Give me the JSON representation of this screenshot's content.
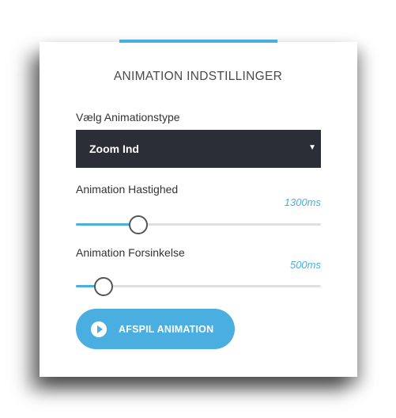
{
  "panel": {
    "title": "ANIMATION INDSTILLINGER"
  },
  "animation_type": {
    "label": "Vælg Animationstype",
    "selected": "Zoom Ind",
    "caret_icon": "triangle-down-icon"
  },
  "speed": {
    "label": "Animation Hastighed",
    "value_text": "1300ms",
    "fraction": 0.25
  },
  "delay": {
    "label": "Animation Forsinkelse",
    "value_text": "500ms",
    "fraction": 0.11
  },
  "play_button": {
    "label": "AFSPIL ANIMATION",
    "icon": "play-icon"
  },
  "colors": {
    "accent": "#4aaee0",
    "select_bg": "#2b2e37",
    "text": "#333333"
  }
}
